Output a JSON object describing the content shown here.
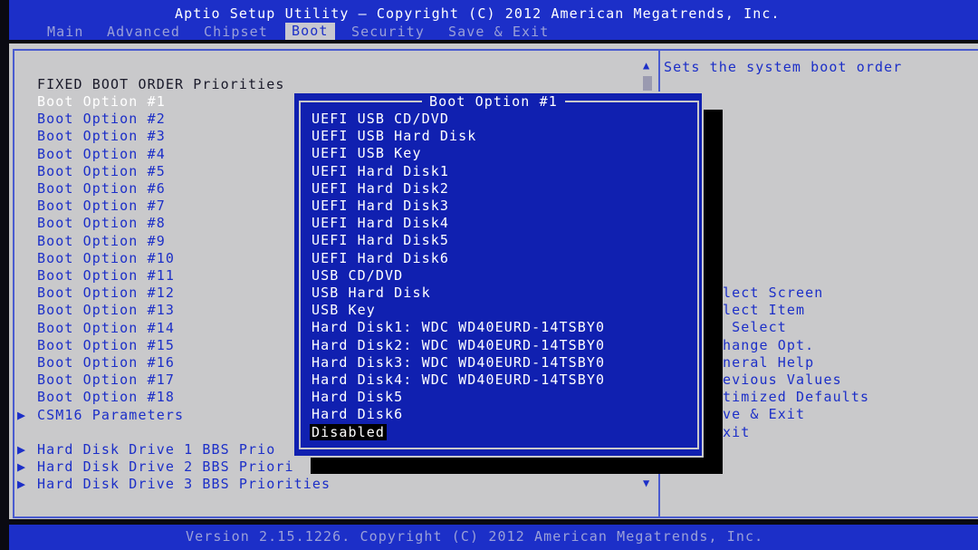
{
  "header": {
    "title": "Aptio Setup Utility – Copyright (C) 2012 American Megatrends, Inc.",
    "tabs": [
      "Main",
      "Advanced",
      "Chipset",
      "Boot",
      "Security",
      "Save & Exit"
    ],
    "active_tab": "Boot"
  },
  "left": {
    "section_heading": "FIXED BOOT ORDER Priorities",
    "boot_options": [
      "Boot Option #1",
      "Boot Option #2",
      "Boot Option #3",
      "Boot Option #4",
      "Boot Option #5",
      "Boot Option #6",
      "Boot Option #7",
      "Boot Option #8",
      "Boot Option #9",
      "Boot Option #10",
      "Boot Option #11",
      "Boot Option #12",
      "Boot Option #13",
      "Boot Option #14",
      "Boot Option #15",
      "Boot Option #16",
      "Boot Option #17",
      "Boot Option #18"
    ],
    "csm16": "CSM16 Parameters",
    "bbs": [
      "Hard Disk Drive 1 BBS Prio",
      "Hard Disk Drive 2 BBS Priori",
      "Hard Disk Drive 3 BBS Priorities"
    ],
    "submenu_arrow": "▶",
    "scroll_up": "▲",
    "scroll_down": "▼"
  },
  "right": {
    "help_text": "Sets the system boot order",
    "key_help": [
      "lect Screen",
      "lect Item",
      " Select",
      "hange Opt.",
      "neral Help",
      "evious Values",
      "timized Defaults",
      "ve & Exit",
      "xit"
    ]
  },
  "popup": {
    "title": "Boot Option #1",
    "options": [
      "UEFI USB CD/DVD",
      "UEFI USB Hard Disk",
      "UEFI USB Key",
      "UEFI Hard Disk1",
      "UEFI Hard Disk2",
      "UEFI Hard Disk3",
      "UEFI Hard Disk4",
      "UEFI Hard Disk5",
      "UEFI Hard Disk6",
      "USB CD/DVD",
      "USB Hard Disk",
      "USB Key",
      "Hard Disk1: WDC WD40EURD-14TSBY0",
      "Hard Disk2: WDC WD40EURD-14TSBY0",
      "Hard Disk3: WDC WD40EURD-14TSBY0",
      "Hard Disk4: WDC WD40EURD-14TSBY0",
      "Hard Disk5",
      "Hard Disk6",
      "Disabled"
    ],
    "selected": "Disabled"
  },
  "footer": {
    "version": "Version 2.15.1226. Copyright (C) 2012 American Megatrends, Inc."
  },
  "colors": {
    "bios_blue": "#1c2fc8",
    "popup_blue": "#1020b0",
    "panel_gray": "#c9c9cb",
    "selected_white": "#ffffff"
  }
}
